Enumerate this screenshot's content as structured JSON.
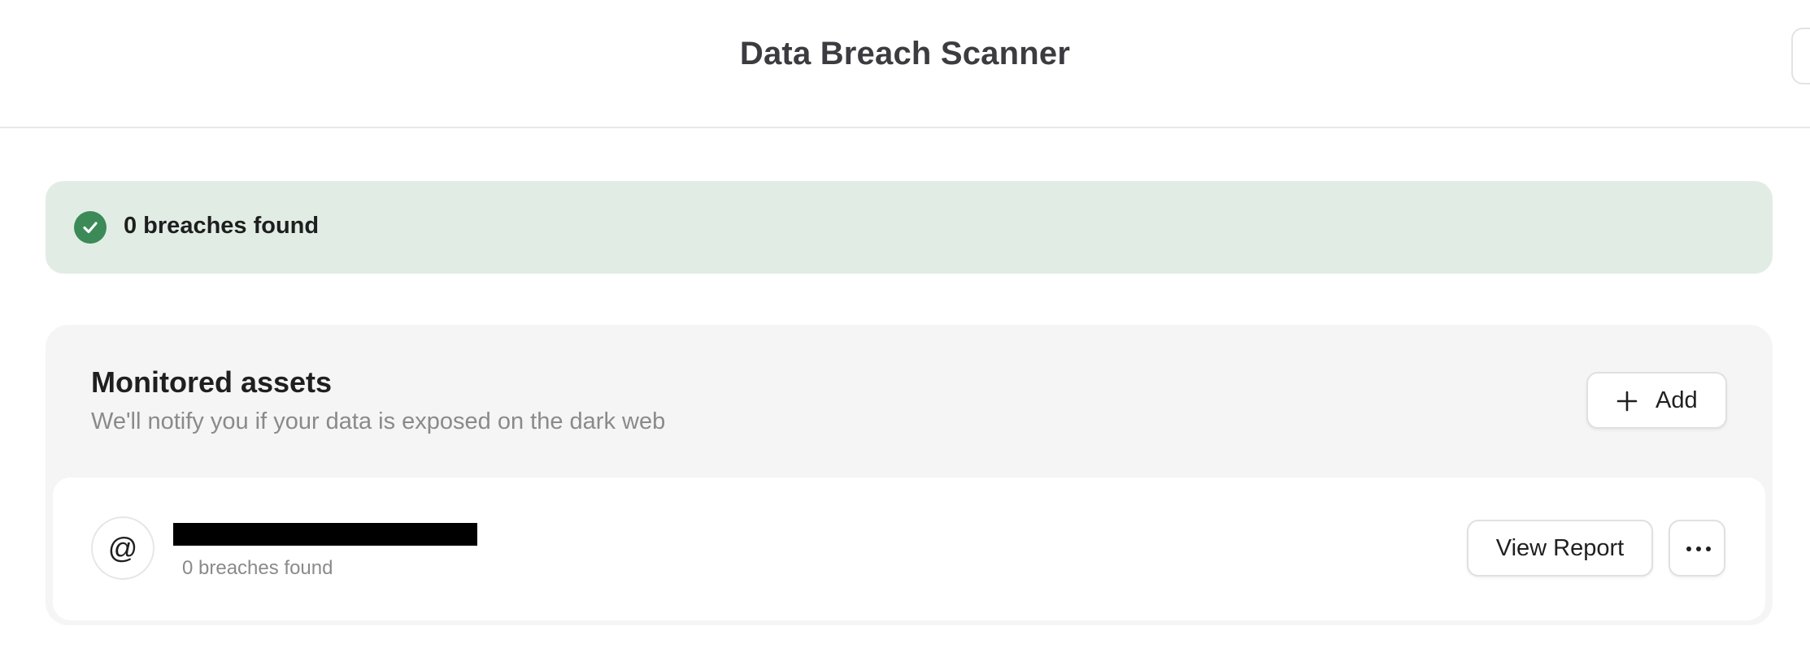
{
  "header": {
    "title": "Data Breach Scanner"
  },
  "status_banner": {
    "icon": "check-circle-icon",
    "text": "0 breaches found",
    "background_color": "#e1ede4",
    "icon_color": "#3c8a57"
  },
  "assets": {
    "title": "Monitored assets",
    "subtitle": "We'll notify you if your data is exposed on the dark web",
    "add_button_label": "Add",
    "add_icon": "plus-icon",
    "items": [
      {
        "icon": "at-sign-icon",
        "icon_glyph": "@",
        "name": "",
        "name_redacted": true,
        "status": "0 breaches found",
        "view_report_label": "View Report",
        "more_icon": "more-horizontal-icon"
      }
    ]
  }
}
